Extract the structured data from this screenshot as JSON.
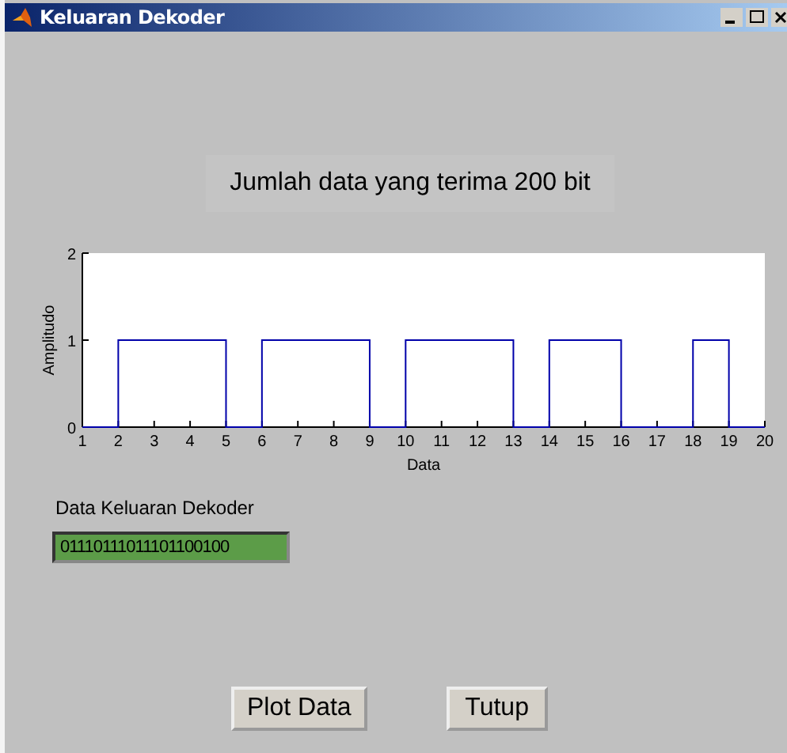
{
  "window": {
    "title": "Keluaran Dekoder"
  },
  "heading": "Jumlah data yang terima 200 bit",
  "chart_data": {
    "type": "line",
    "xlabel": "Data",
    "ylabel": "Amplitudo",
    "x": [
      1,
      2,
      2,
      5,
      5,
      6,
      6,
      9,
      9,
      10,
      10,
      13,
      13,
      14,
      14,
      16,
      16,
      18,
      18,
      19,
      19,
      20
    ],
    "series": [
      {
        "color": "#0000aa",
        "values": [
          0,
          0,
          1,
          1,
          0,
          0,
          1,
          1,
          0,
          0,
          1,
          1,
          0,
          0,
          1,
          1,
          0,
          0,
          1,
          1,
          0,
          0
        ]
      }
    ],
    "xlim": [
      1,
      20
    ],
    "ylim": [
      0,
      2
    ],
    "xticks": [
      1,
      2,
      3,
      4,
      5,
      6,
      7,
      8,
      9,
      10,
      11,
      12,
      13,
      14,
      15,
      16,
      17,
      18,
      19,
      20
    ],
    "yticks": [
      0,
      1,
      2
    ]
  },
  "output": {
    "label": "Data Keluaran Dekoder",
    "value": "01110111011101100100"
  },
  "buttons": [
    "Plot Data",
    "Tutup"
  ]
}
